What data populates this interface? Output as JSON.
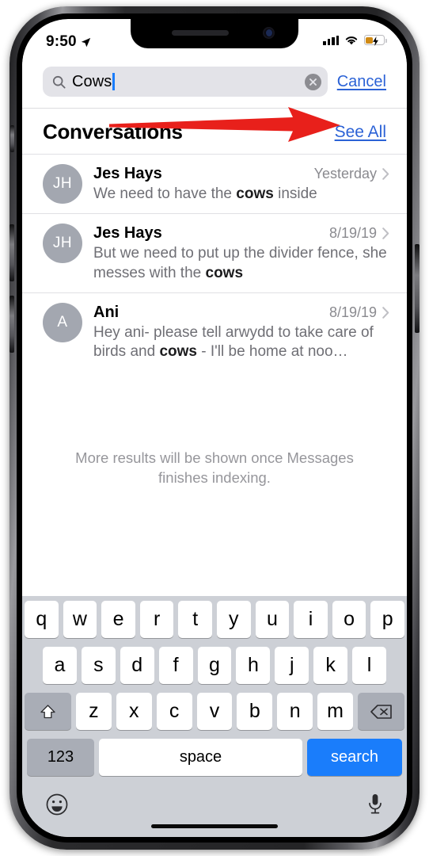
{
  "status_bar": {
    "time": "9:50",
    "location_icon": "location-arrow-icon",
    "signal_icon": "cellular-signal-icon",
    "signal_bars": 4,
    "wifi_icon": "wifi-icon",
    "battery_icon": "battery-charging-icon",
    "battery_color": "#d08a14"
  },
  "search": {
    "icon": "search-icon",
    "value": "Cows",
    "placeholder": "Search",
    "clear_icon": "clear-circle-icon",
    "cancel_label": "Cancel",
    "accent_color": "#2b62d6",
    "caret_color": "#1a7dfb"
  },
  "section": {
    "title": "Conversations",
    "see_all_label": "See All",
    "annotation": {
      "type": "red-arrow",
      "color": "#e8201b",
      "points_to": "See All"
    }
  },
  "results": [
    {
      "initials": "JH",
      "name": "Jes Hays",
      "date": "Yesterday",
      "snippet_pre": "We need to have the ",
      "snippet_match": "cows",
      "snippet_post": " inside",
      "chevron_icon": "chevron-right-icon"
    },
    {
      "initials": "JH",
      "name": "Jes Hays",
      "date": "8/19/19",
      "snippet_pre": "But we need to put up the divider fence, she messes with the ",
      "snippet_match": "cows",
      "snippet_post": "",
      "chevron_icon": "chevron-right-icon"
    },
    {
      "initials": "A",
      "name": "Ani",
      "date": "8/19/19",
      "snippet_pre": "Hey ani- please tell arwydd to take care of birds and ",
      "snippet_match": "cows",
      "snippet_post": " - I'll be home at noo…",
      "chevron_icon": "chevron-right-icon"
    }
  ],
  "footer_note": "More results will be shown once Messages finishes indexing.",
  "keyboard": {
    "row1": [
      "q",
      "w",
      "e",
      "r",
      "t",
      "y",
      "u",
      "i",
      "o",
      "p"
    ],
    "row2": [
      "a",
      "s",
      "d",
      "f",
      "g",
      "h",
      "j",
      "k",
      "l"
    ],
    "row3": [
      "z",
      "x",
      "c",
      "v",
      "b",
      "n",
      "m"
    ],
    "shift_icon": "shift-arrow-icon",
    "backspace_icon": "backspace-delete-icon",
    "numbers_label": "123",
    "space_label": "space",
    "return_label": "search",
    "return_color": "#1a7dfb",
    "emoji_icon": "emoji-smiley-icon",
    "dictation_icon": "microphone-icon"
  },
  "home_indicator": "home-indicator-bar"
}
